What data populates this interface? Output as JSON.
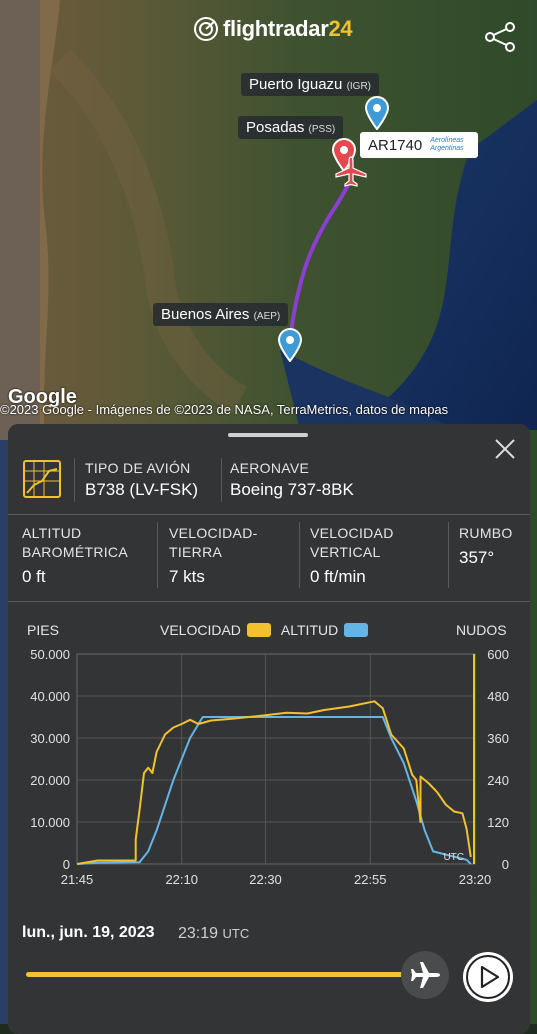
{
  "app": {
    "logo_text": "flightradar",
    "logo_num": "24"
  },
  "map": {
    "labels": {
      "igr_city": "Puerto Iguazu",
      "igr_code": "(IGR)",
      "pss_city": "Posadas",
      "pss_code": "(PSS)",
      "aep_city": "Buenos Aires",
      "aep_code": "(AEP)"
    },
    "flight_tag": "AR1740",
    "airline_name": "Aerolíneas Argentinas",
    "google_logo": "Google",
    "attribution": "©2023 Google - Imágenes de ©2023 de NASA, TerraMetrics, datos de mapas",
    "route_color": "#8a3fd1"
  },
  "panel": {
    "aircraft_type_label": "TIPO DE AVIÓN",
    "aircraft_type_value": "B738 (LV-FSK)",
    "aircraft_label": "AERONAVE",
    "aircraft_value": "Boeing 737-8BK",
    "stats": [
      {
        "label1": "ALTITUD",
        "label2": "BAROMÉTRICA",
        "value": "0 ft"
      },
      {
        "label1": "VELOCIDAD-",
        "label2": "TIERRA",
        "value": "7 kts"
      },
      {
        "label1": "VELOCIDAD",
        "label2": "VERTICAL",
        "value": "0 ft/min"
      },
      {
        "label1": "RUMBO",
        "label2": "",
        "value": "357°"
      }
    ],
    "chart_legend": {
      "left_unit": "PIES",
      "speed": "VELOCIDAD",
      "altitude": "ALTITUD",
      "right_unit": "NUDOS"
    },
    "date": "lun., jun. 19, 2023",
    "time": "23:19",
    "time_zone": "UTC"
  },
  "colors": {
    "speed": "#f2c12e",
    "altitude": "#64b5e6",
    "accent": "#f2c12e"
  },
  "playback": {
    "progress": 0.98
  },
  "chart_data": {
    "type": "line",
    "x_ticks": [
      "21:45",
      "22:10",
      "22:30",
      "22:55",
      "23:20"
    ],
    "y_left_ticks": [
      "50.000",
      "40.000",
      "30.000",
      "20.000",
      "10.000",
      "0"
    ],
    "y_right_ticks": [
      "600",
      "480",
      "360",
      "240",
      "120",
      "0"
    ],
    "ylim_left": [
      0,
      50000
    ],
    "ylim_right": [
      0,
      600
    ],
    "utc_tag": "UTC",
    "series": [
      {
        "name": "ALTITUD",
        "axis": "left",
        "color": "#64b5e6",
        "points": [
          [
            "21:45",
            0
          ],
          [
            "21:50",
            300
          ],
          [
            "22:00",
            400
          ],
          [
            "22:00",
            500
          ],
          [
            "22:02",
            3000
          ],
          [
            "22:04",
            8000
          ],
          [
            "22:06",
            14000
          ],
          [
            "22:08",
            20000
          ],
          [
            "22:10",
            25000
          ],
          [
            "22:12",
            30000
          ],
          [
            "22:15",
            35000
          ],
          [
            "22:20",
            35000
          ],
          [
            "22:30",
            35000
          ],
          [
            "22:40",
            35000
          ],
          [
            "22:50",
            35000
          ],
          [
            "22:58",
            35000
          ],
          [
            "23:00",
            30000
          ],
          [
            "23:03",
            24000
          ],
          [
            "23:06",
            15000
          ],
          [
            "23:08",
            8000
          ],
          [
            "23:10",
            3000
          ],
          [
            "23:14",
            2000
          ],
          [
            "23:18",
            1000
          ],
          [
            "23:19",
            0
          ]
        ]
      },
      {
        "name": "VELOCIDAD",
        "axis": "right",
        "color": "#f2c12e",
        "points": [
          [
            "21:45",
            0
          ],
          [
            "21:50",
            10
          ],
          [
            "21:59",
            10
          ],
          [
            "21:59",
            70
          ],
          [
            "22:00",
            160
          ],
          [
            "22:01",
            260
          ],
          [
            "22:02",
            275
          ],
          [
            "22:03",
            260
          ],
          [
            "22:04",
            320
          ],
          [
            "22:06",
            370
          ],
          [
            "22:08",
            390
          ],
          [
            "22:10",
            400
          ],
          [
            "22:12",
            412
          ],
          [
            "22:14",
            400
          ],
          [
            "22:17",
            410
          ],
          [
            "22:22",
            415
          ],
          [
            "22:30",
            425
          ],
          [
            "22:35",
            432
          ],
          [
            "22:40",
            430
          ],
          [
            "22:44",
            440
          ],
          [
            "22:50",
            450
          ],
          [
            "22:56",
            465
          ],
          [
            "22:58",
            445
          ],
          [
            "23:00",
            370
          ],
          [
            "23:03",
            330
          ],
          [
            "23:05",
            255
          ],
          [
            "23:06",
            240
          ],
          [
            "23:07",
            120
          ],
          [
            "23:07",
            250
          ],
          [
            "23:09",
            230
          ],
          [
            "23:11",
            205
          ],
          [
            "23:13",
            170
          ],
          [
            "23:15",
            150
          ],
          [
            "23:17",
            145
          ],
          [
            "23:18",
            100
          ],
          [
            "23:19",
            20
          ]
        ]
      }
    ]
  }
}
